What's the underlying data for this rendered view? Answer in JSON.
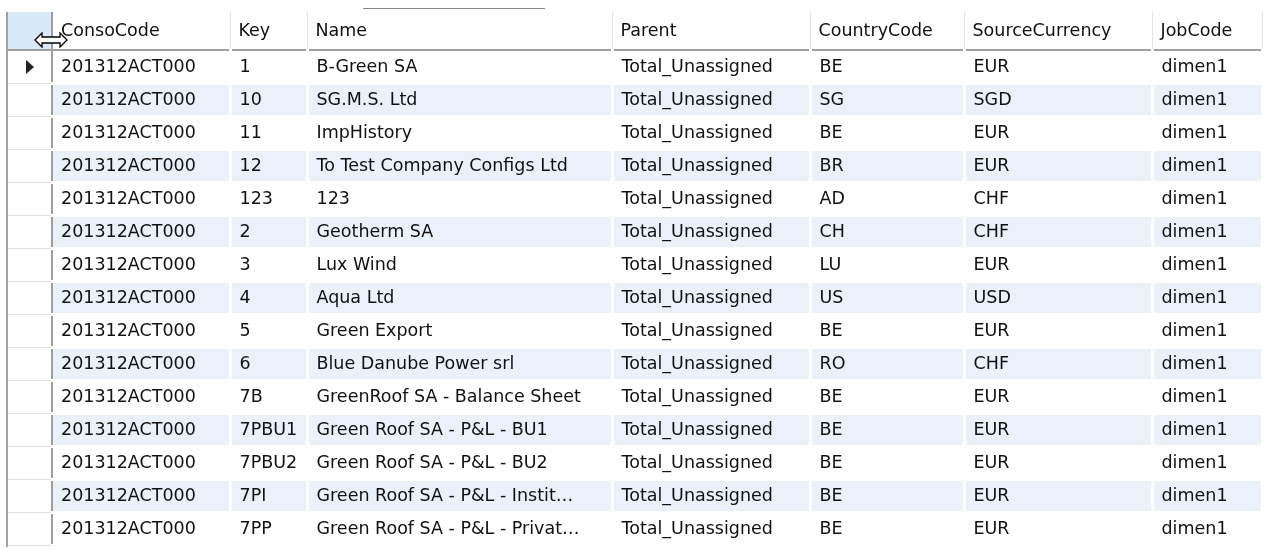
{
  "grid": {
    "columns": [
      "ConsoCode",
      "Key",
      "Name",
      "Parent",
      "CountryCode",
      "SourceCurrency",
      "JobCode"
    ],
    "rows": [
      {
        "current": true,
        "cells": [
          "201312ACT000",
          "1",
          "B-Green SA",
          "Total_Unassigned",
          "BE",
          "EUR",
          "dimen1"
        ]
      },
      {
        "current": false,
        "cells": [
          "201312ACT000",
          "10",
          "SG.M.S. Ltd",
          "Total_Unassigned",
          "SG",
          "SGD",
          "dimen1"
        ]
      },
      {
        "current": false,
        "cells": [
          "201312ACT000",
          "11",
          "ImpHistory",
          "Total_Unassigned",
          "BE",
          "EUR",
          "dimen1"
        ]
      },
      {
        "current": false,
        "cells": [
          "201312ACT000",
          "12",
          "To Test Company Configs Ltd",
          "Total_Unassigned",
          "BR",
          "EUR",
          "dimen1"
        ]
      },
      {
        "current": false,
        "cells": [
          "201312ACT000",
          "123",
          "123",
          "Total_Unassigned",
          "AD",
          "CHF",
          "dimen1"
        ]
      },
      {
        "current": false,
        "cells": [
          "201312ACT000",
          "2",
          "Geotherm SA",
          "Total_Unassigned",
          "CH",
          "CHF",
          "dimen1"
        ]
      },
      {
        "current": false,
        "cells": [
          "201312ACT000",
          "3",
          "Lux Wind",
          "Total_Unassigned",
          "LU",
          "EUR",
          "dimen1"
        ]
      },
      {
        "current": false,
        "cells": [
          "201312ACT000",
          "4",
          "Aqua Ltd",
          "Total_Unassigned",
          "US",
          "USD",
          "dimen1"
        ]
      },
      {
        "current": false,
        "cells": [
          "201312ACT000",
          "5",
          "Green Export",
          "Total_Unassigned",
          "BE",
          "EUR",
          "dimen1"
        ]
      },
      {
        "current": false,
        "cells": [
          "201312ACT000",
          "6",
          "Blue Danube Power srl",
          "Total_Unassigned",
          "RO",
          "CHF",
          "dimen1"
        ]
      },
      {
        "current": false,
        "cells": [
          "201312ACT000",
          "7B",
          "GreenRoof SA - Balance Sheet",
          "Total_Unassigned",
          "BE",
          "EUR",
          "dimen1"
        ]
      },
      {
        "current": false,
        "cells": [
          "201312ACT000",
          "7PBU1",
          "Green Roof SA - P&L - BU1",
          "Total_Unassigned",
          "BE",
          "EUR",
          "dimen1"
        ]
      },
      {
        "current": false,
        "cells": [
          "201312ACT000",
          "7PBU2",
          "Green Roof SA - P&L - BU2",
          "Total_Unassigned",
          "BE",
          "EUR",
          "dimen1"
        ]
      },
      {
        "current": false,
        "cells": [
          "201312ACT000",
          "7PI",
          "Green Roof SA - P&L - Instit…",
          "Total_Unassigned",
          "BE",
          "EUR",
          "dimen1"
        ]
      },
      {
        "current": false,
        "cells": [
          "201312ACT000",
          "7PP",
          "Green Roof SA - P&L - Privat…",
          "Total_Unassigned",
          "BE",
          "EUR",
          "dimen1"
        ]
      }
    ]
  }
}
